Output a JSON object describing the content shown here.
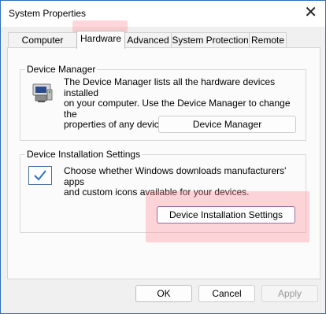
{
  "window": {
    "title": "System Properties",
    "close_label": "✕"
  },
  "tabs": [
    {
      "label": "Computer Name"
    },
    {
      "label": "Hardware"
    },
    {
      "label": "Advanced"
    },
    {
      "label": "System Protection"
    },
    {
      "label": "Remote"
    }
  ],
  "device_manager": {
    "title": "Device Manager",
    "line1": "The Device Manager lists all the hardware devices installed",
    "line2": "on your computer. Use the Device Manager to change the",
    "line3": "properties of any device.",
    "button": "Device Manager"
  },
  "device_installation": {
    "title": "Device Installation Settings",
    "line1": "Choose whether Windows downloads manufacturers' apps",
    "line2": "and custom icons available for your devices.",
    "button": "Device Installation Settings"
  },
  "footer": {
    "ok": "OK",
    "cancel": "Cancel",
    "apply": "Apply"
  },
  "colors": {
    "accent": "#2e6fb8",
    "highlight": "#ff8c96"
  }
}
